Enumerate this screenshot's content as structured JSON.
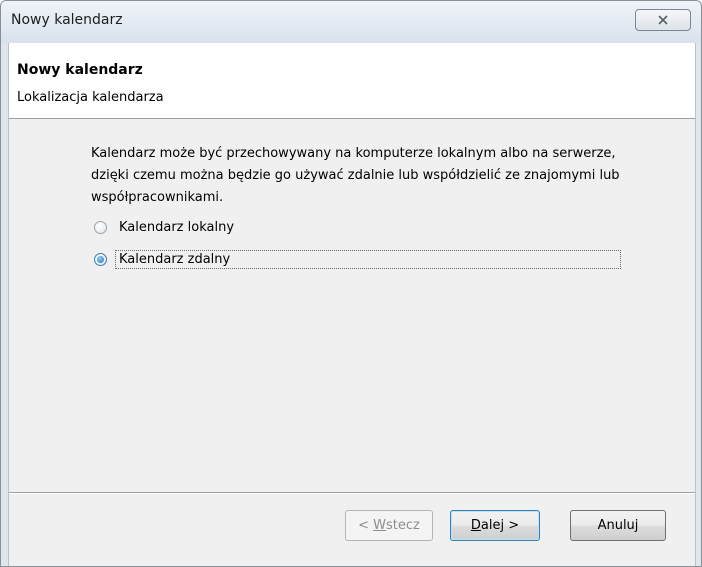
{
  "window": {
    "title": "Nowy kalendarz",
    "close_icon": "close-icon"
  },
  "header": {
    "title": "Nowy kalendarz",
    "subtitle": "Lokalizacja kalendarza"
  },
  "content": {
    "description": "Kalendarz może być przechowywany na komputerze lokalnym albo na serwerze, dzięki czemu można będzie go używać zdalnie lub współdzielić ze znajomymi lub współpracownikami.",
    "options": [
      {
        "label": "Kalendarz lokalny",
        "selected": false
      },
      {
        "label": "Kalendarz zdalny",
        "selected": true
      }
    ]
  },
  "buttons": {
    "back": {
      "prefix": "< ",
      "mnemonic": "W",
      "rest": "stecz",
      "enabled": false
    },
    "next": {
      "mnemonic": "D",
      "rest": "alej >",
      "enabled": true
    },
    "cancel": {
      "label": "Anuluj",
      "enabled": true
    }
  }
}
